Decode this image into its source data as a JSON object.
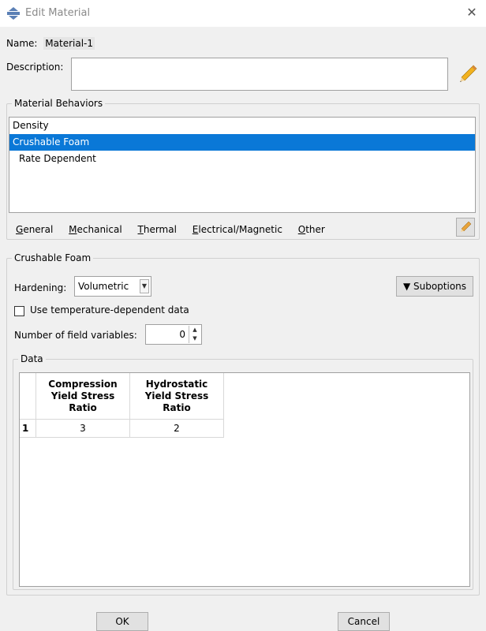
{
  "window": {
    "title": "Edit Material"
  },
  "name": {
    "label": "Name:",
    "value": "Material-1"
  },
  "description": {
    "label": "Description:",
    "value": ""
  },
  "material_behaviors": {
    "title": "Material Behaviors",
    "items": [
      {
        "label": "Density",
        "selected": false
      },
      {
        "label": "Crushable Foam",
        "selected": true
      },
      {
        "label": "Rate Dependent",
        "selected": false
      }
    ],
    "menu": [
      {
        "label": "General",
        "mnemonic": "G",
        "rest": "eneral"
      },
      {
        "label": "Mechanical",
        "mnemonic": "M",
        "rest": "echanical"
      },
      {
        "label": "Thermal",
        "mnemonic": "T",
        "rest": "hermal"
      },
      {
        "label": "Electrical/Magnetic",
        "mnemonic": "E",
        "rest": "lectrical/Magnetic"
      },
      {
        "label": "Other",
        "mnemonic": "O",
        "rest": "ther"
      }
    ]
  },
  "crushable_foam": {
    "title": "Crushable Foam",
    "hardening_label": "Hardening:",
    "hardening_value": "Volumetric",
    "suboptions_label": "Suboptions",
    "temp_dependent_label": "Use temperature-dependent data",
    "temp_dependent_checked": false,
    "field_vars_label": "Number of field variables:",
    "field_vars_value": "0",
    "data": {
      "title": "Data",
      "columns": [
        "Compression\nYield Stress\nRatio",
        "Hydrostatic\nYield Stress\nRatio"
      ],
      "rows": [
        {
          "num": "1",
          "values": [
            "3",
            "2"
          ]
        }
      ]
    }
  },
  "buttons": {
    "ok": "OK",
    "cancel": "Cancel"
  },
  "colors": {
    "selection": "#0a78d7",
    "dialog_bg": "#f0f0f0"
  }
}
